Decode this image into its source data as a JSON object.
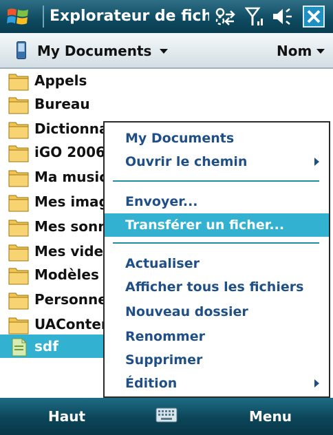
{
  "title_bar": {
    "title": "Explorateur de fichier",
    "icons": [
      "windows-start-icon",
      "sync-arrows-icon",
      "signal-antenna-icon",
      "volume-icon",
      "close-icon"
    ],
    "close_label": "✕"
  },
  "header": {
    "folder": "My Documents",
    "sort": "Nom",
    "icons": [
      "phone-device-icon",
      "chevron-down-icon"
    ]
  },
  "file_list": {
    "items": [
      {
        "label": "Appels",
        "icon": "folder-icon"
      },
      {
        "label": "Bureau",
        "icon": "folder-icon"
      },
      {
        "label": "Dictionnai",
        "icon": "folder-icon"
      },
      {
        "label": "iGO 2006",
        "icon": "folder-icon"
      },
      {
        "label": "Ma music",
        "icon": "folder-icon"
      },
      {
        "label": "Mes imag",
        "icon": "folder-icon"
      },
      {
        "label": "Mes sonn",
        "icon": "folder-icon"
      },
      {
        "label": "Mes vide",
        "icon": "folder-icon"
      },
      {
        "label": "Modèles",
        "icon": "folder-icon"
      },
      {
        "label": "Personne",
        "icon": "folder-icon"
      },
      {
        "label": "UAConter",
        "icon": "folder-icon"
      },
      {
        "label": "sdf",
        "icon": "file-icon",
        "selected": true
      }
    ]
  },
  "context_menu": {
    "items": [
      {
        "label": "My Documents"
      },
      {
        "label": "Ouvrir le chemin",
        "submenu": true
      },
      {
        "label": "Envoyer..."
      },
      {
        "label": "Transférer un ficher...",
        "highlighted": true
      },
      {
        "label": "Actualiser"
      },
      {
        "label": "Afficher tous les fichiers"
      },
      {
        "label": "Nouveau dossier"
      },
      {
        "label": "Renommer"
      },
      {
        "label": "Supprimer"
      },
      {
        "label": "Édition",
        "submenu": true
      }
    ]
  },
  "softkeys": {
    "left": "Haut",
    "right": "Menu",
    "center_icon": "keyboard-icon"
  },
  "colors": {
    "highlight": "#32b1d1",
    "menu_text": "#1f4f86",
    "bar_dark": "#0c4558"
  }
}
